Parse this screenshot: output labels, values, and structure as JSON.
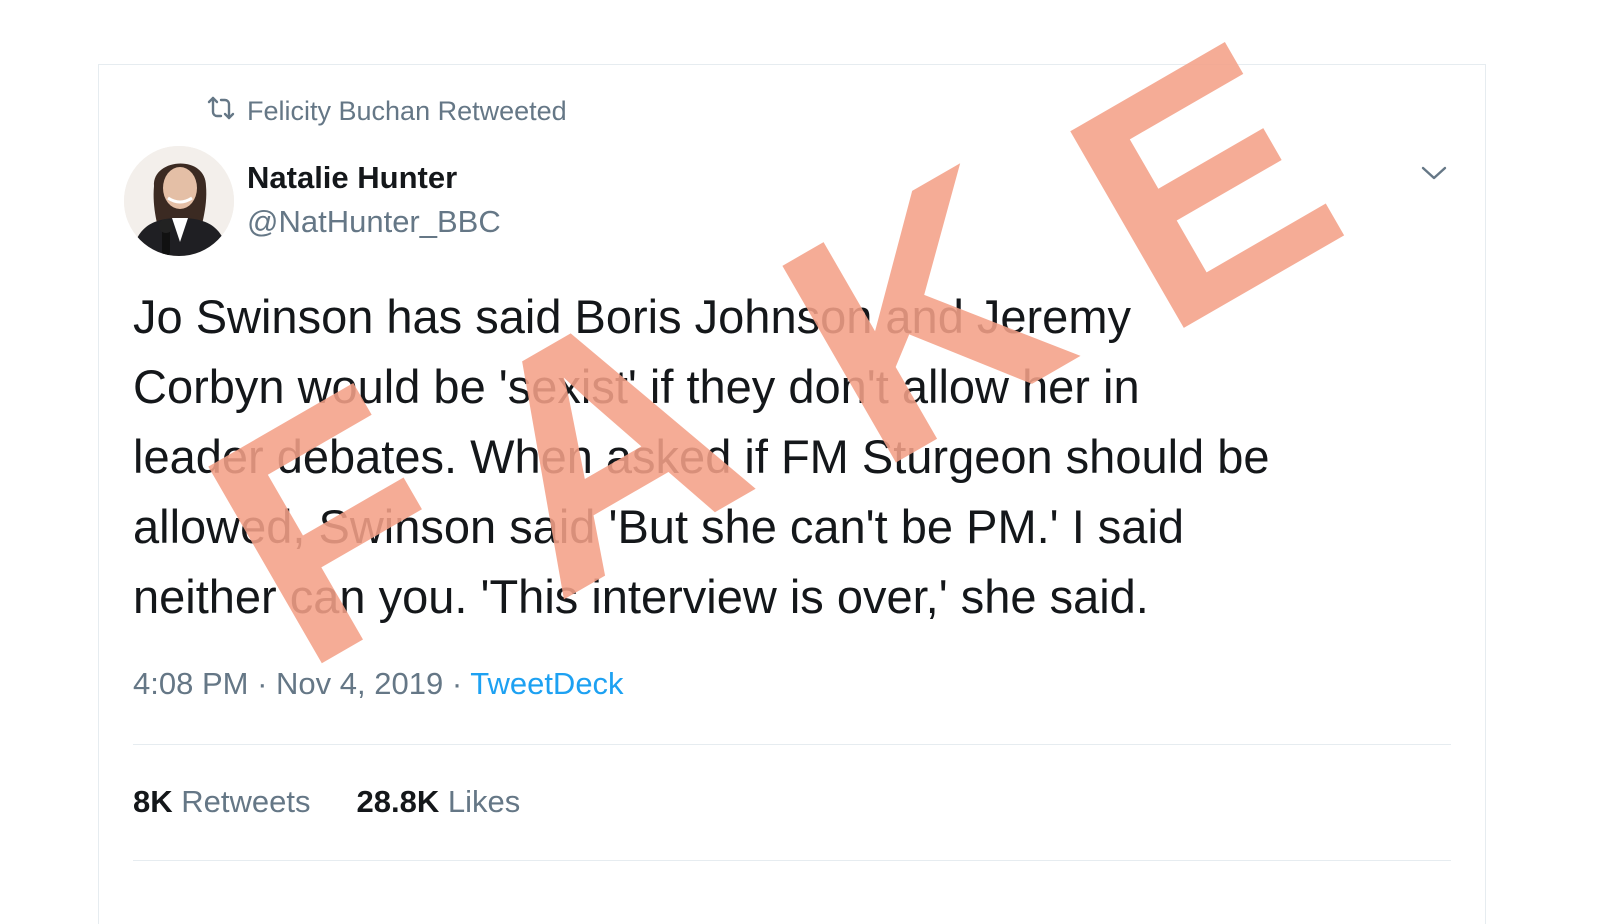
{
  "retweet": {
    "text": "Felicity Buchan Retweeted",
    "icon": "retweet-icon"
  },
  "author": {
    "name": "Natalie Hunter",
    "handle": "@NatHunter_BBC"
  },
  "tweet": {
    "lines": [
      "Jo Swinson has said Boris Johnson and Jeremy",
      "Corbyn would be 'sexist' if they don't allow her in",
      "leader debates. When asked if FM Sturgeon should be",
      "allowed, Swinson said 'But she can't be PM.' I said",
      "neither can you. 'This interview is over,' she said."
    ],
    "time": "4:08 PM",
    "separator1": "·",
    "date": "Nov 4, 2019",
    "separator2": "·",
    "source": "TweetDeck"
  },
  "stats": {
    "retweets_count": "8K",
    "retweets_label": "Retweets",
    "likes_count": "28.8K",
    "likes_label": "Likes"
  },
  "overlay": {
    "letters": [
      "F",
      "A",
      "K",
      "E"
    ],
    "color": "#f4a088"
  },
  "colors": {
    "text_primary": "#14171a",
    "text_secondary": "#657786",
    "link": "#1da1f2",
    "border": "#e6ecf0"
  }
}
